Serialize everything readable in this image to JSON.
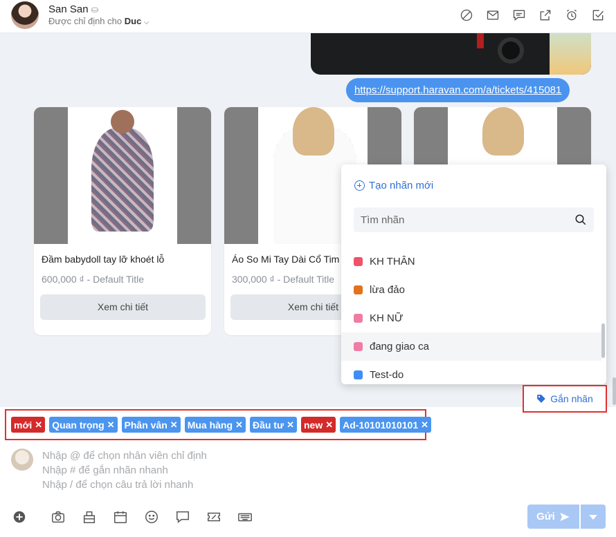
{
  "header": {
    "name": "San San",
    "assigned_prefix": "Được chỉ định cho",
    "assignee": "Duc",
    "icons": [
      "block-icon",
      "mail-icon",
      "comment-icon",
      "open-external-icon",
      "alarm-icon",
      "checkbox-icon"
    ]
  },
  "chat": {
    "link": "https://support.haravan.com/a/tickets/415081",
    "products": [
      {
        "title": "Đầm babydoll tay lỡ khoét lỗ",
        "price": "600,000 ₫ - Default Title",
        "button": "Xem chi tiết"
      },
      {
        "title": "Áo So Mi Tay Dài Cổ Tim",
        "price": "300,000 ₫ - Default Title",
        "button": "Xem chi tiết"
      },
      {
        "title": "",
        "price": "",
        "button": ""
      }
    ]
  },
  "label_dropdown": {
    "create_label": "Tạo nhãn mới",
    "search_placeholder": "Tìm nhãn",
    "items": [
      {
        "label": "KH THÂN",
        "color": "#f0526a"
      },
      {
        "label": "lừa đảo",
        "color": "#e2721e"
      },
      {
        "label": "KH NỮ",
        "color": "#f07ca6"
      },
      {
        "label": "đang giao ca",
        "color": "#f07ca6"
      },
      {
        "label": "Test-do",
        "color": "#3e8ef7"
      }
    ]
  },
  "assign_button": {
    "label": "Gắn nhãn"
  },
  "selected_tags": [
    {
      "label": "mới",
      "color": "#d42a2a"
    },
    {
      "label": "Quan trọng",
      "color": "#4b95ef"
    },
    {
      "label": "Phân vân",
      "color": "#4b95ef"
    },
    {
      "label": "Mua hàng",
      "color": "#4b95ef"
    },
    {
      "label": "Đầu tư",
      "color": "#4b95ef"
    },
    {
      "label": "new",
      "color": "#d42a2a"
    },
    {
      "label": "Ad-10101010101",
      "color": "#4b95ef"
    }
  ],
  "composer": {
    "placeholder": "Nhập @ để chọn nhân viên chỉ định\nNhập # để gắn nhãn nhanh\nNhập / để chọn câu trả lời nhanh"
  },
  "toolbar_icons": [
    "plus-circle-icon",
    "camera-icon",
    "product-box-icon",
    "calendar-icon",
    "emoji-icon",
    "speech-bubble-icon",
    "discount-icon",
    "keyboard-icon"
  ],
  "send": {
    "label": "Gửi"
  },
  "colors": {
    "accent": "#2f6fd6",
    "highlight_border": "#e03030",
    "send_disabled": "#a9c8f5"
  }
}
